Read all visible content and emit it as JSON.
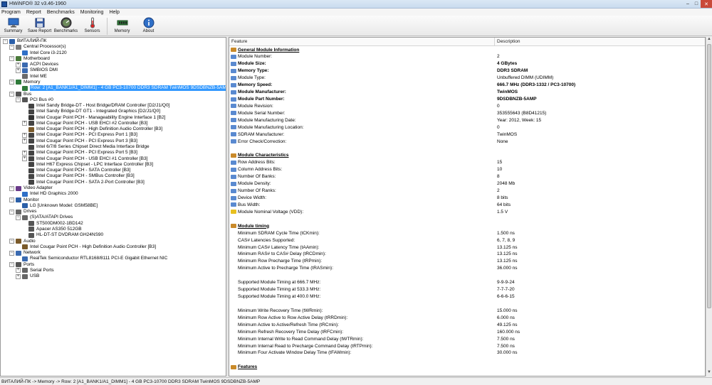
{
  "window": {
    "title": "HWiNFO® 32 v3.46-1960"
  },
  "menu": [
    "Program",
    "Report",
    "Benchmarks",
    "Monitoring",
    "Help"
  ],
  "toolbar": [
    {
      "label": "Summary",
      "icon": "monitor-icon"
    },
    {
      "label": "Save Report",
      "icon": "floppy-disk-icon"
    },
    {
      "label": "Benchmarks",
      "icon": "gauge-icon"
    },
    {
      "label": "Sensors",
      "icon": "thermometer-icon"
    },
    {
      "label": "Memory",
      "icon": "memory-module-icon"
    },
    {
      "label": "About",
      "icon": "info-icon"
    }
  ],
  "tree": [
    {
      "label": "ВИТАЛИЙ-ПК",
      "expander": "−"
    },
    {
      "label": "Central Processor(s)",
      "expander": "−"
    },
    {
      "label": "Intel Core i3-2120",
      "expander": ""
    },
    {
      "label": "Motherboard",
      "expander": "−"
    },
    {
      "label": "ACPI Devices",
      "expander": "+"
    },
    {
      "label": "SMBIOS DMI",
      "expander": "+"
    },
    {
      "label": "Intel ME",
      "expander": ""
    },
    {
      "label": "Memory",
      "expander": "−"
    },
    {
      "label": "Row: 2 [A1_BANK1/A1_DIMM1] - 4 GB PC3-10700 DDR3 SDRAM TwinMOS 9DSDBNZB-5AMP",
      "expander": "",
      "selected": true
    },
    {
      "label": "Bus",
      "expander": "−"
    },
    {
      "label": "PCI Bus #0",
      "expander": "−"
    },
    {
      "label": "Intel Sandy Bridge-DT - Host Bridge/DRAM Controller [D2/J1/Q0]",
      "expander": ""
    },
    {
      "label": "Intel Sandy Bridge-DT GT1 - Integrated Graphics [D2/J1/Q0]",
      "expander": ""
    },
    {
      "label": "Intel Cougar Point PCH - Manageability Engine Interface 1 [B2]",
      "expander": ""
    },
    {
      "label": "Intel Cougar Point PCH - USB EHCI #2 Controller [B3]",
      "expander": "+"
    },
    {
      "label": "Intel Cougar Point PCH - High Definition Audio Controller [B3]",
      "expander": ""
    },
    {
      "label": "Intel Cougar Point PCH - PCI Express Port 1 [B3]",
      "expander": "+"
    },
    {
      "label": "Intel Cougar Point PCH - PCI Express Port 3 [B3]",
      "expander": "+"
    },
    {
      "label": "Intel 6/7/8 Series Chipset Direct Media Interface Bridge",
      "expander": ""
    },
    {
      "label": "Intel Cougar Point PCH - PCI Express Port 5 [B3]",
      "expander": "+"
    },
    {
      "label": "Intel Cougar Point PCH - USB EHCI #1 Controller [B3]",
      "expander": "+"
    },
    {
      "label": "Intel H67 Express Chipset - LPC Interface Controller [B3]",
      "expander": ""
    },
    {
      "label": "Intel Cougar Point PCH - SATA Controller [B3]",
      "expander": ""
    },
    {
      "label": "Intel Cougar Point PCH - SMBus Controller [B3]",
      "expander": ""
    },
    {
      "label": "Intel Cougar Point PCH - SATA 2-Port Controller [B3]",
      "expander": ""
    },
    {
      "label": "Video Adapter",
      "expander": "−"
    },
    {
      "label": "Intel HD Graphics 2000",
      "expander": ""
    },
    {
      "label": "Monitor",
      "expander": "−"
    },
    {
      "label": "LG [Unknown Model: GSM58BE]",
      "expander": ""
    },
    {
      "label": "Drives",
      "expander": "−"
    },
    {
      "label": "(S)ATA/ATAPI Drives",
      "expander": "−"
    },
    {
      "label": "ST500DM002-1BD142",
      "expander": ""
    },
    {
      "label": "Apacer AS350 512GB",
      "expander": ""
    },
    {
      "label": "HL-DT-ST DVDRAM GH24NS90",
      "expander": ""
    },
    {
      "label": "Audio",
      "expander": "−"
    },
    {
      "label": "Intel Cougar Point PCH - High Definition Audio Controller [B3]",
      "expander": ""
    },
    {
      "label": "Network",
      "expander": "−"
    },
    {
      "label": "RealTek Semiconductor RTL8168/8111 PCI-E Gigabit Ethernet NIC",
      "expander": ""
    },
    {
      "label": "Ports",
      "expander": "−"
    },
    {
      "label": "Serial Ports",
      "expander": "+"
    },
    {
      "label": "USB",
      "expander": "+"
    }
  ],
  "details": {
    "header_feature": "Feature",
    "header_description": "Description",
    "rows": [
      {
        "f": "General Module Information",
        "d": "",
        "type": "section"
      },
      {
        "f": "Module Number:",
        "d": "2"
      },
      {
        "f": "Module Size:",
        "d": "4 GBytes",
        "bold": true
      },
      {
        "f": "Memory Type:",
        "d": "DDR3 SDRAM",
        "bold": true
      },
      {
        "f": "Module Type:",
        "d": "Unbuffered DIMM (UDIMM)"
      },
      {
        "f": "Memory Speed:",
        "d": "666.7 MHz (DDR3-1332 / PC3-10700)",
        "bold": true
      },
      {
        "f": "Module Manufacturer:",
        "d": "TwinMOS",
        "bold": true
      },
      {
        "f": "Module Part Number:",
        "d": "9DSDBNZB-5AMP",
        "bold": true
      },
      {
        "f": "Module Revision:",
        "d": "0"
      },
      {
        "f": "Module Serial Number:",
        "d": "353555643 (B8D41215)"
      },
      {
        "f": "Module Manufacturing Date:",
        "d": "Year: 2012, Week: 15"
      },
      {
        "f": "Module Manufacturing Location:",
        "d": "0"
      },
      {
        "f": "SDRAM Manufacturer:",
        "d": "TwinMOS"
      },
      {
        "f": "Error Check/Correction:",
        "d": "None"
      },
      {
        "f": "",
        "d": "",
        "type": "blank"
      },
      {
        "f": "Module Characteristics",
        "d": "",
        "type": "section"
      },
      {
        "f": "Row Address Bits:",
        "d": "15"
      },
      {
        "f": "Column Address Bits:",
        "d": "10"
      },
      {
        "f": "Number Of Banks:",
        "d": "8"
      },
      {
        "f": "Module Density:",
        "d": "2048 Mb"
      },
      {
        "f": "Number Of Ranks:",
        "d": "2"
      },
      {
        "f": "Device Width:",
        "d": "8 bits"
      },
      {
        "f": "Bus Width:",
        "d": "64 bits"
      },
      {
        "f": "Module Nominal Voltage (VDD):",
        "d": "1.5 V",
        "icon": "lightning-icon"
      },
      {
        "f": "",
        "d": "",
        "type": "blank"
      },
      {
        "f": "Module timing",
        "d": "",
        "type": "section"
      },
      {
        "f": "Minimum SDRAM Cycle Time (tCKmin):",
        "d": "1.500 ns",
        "type": "sub"
      },
      {
        "f": "CAS# Latencies Supported:",
        "d": "6, 7, 8, 9",
        "type": "sub"
      },
      {
        "f": "Minimum CAS# Latency Time (tAAmin):",
        "d": "13.125 ns",
        "type": "sub"
      },
      {
        "f": "Minimum RAS# to CAS# Delay (tRCDmin):",
        "d": "13.125 ns",
        "type": "sub"
      },
      {
        "f": "Minimum Row Precharge Time (tRPmin):",
        "d": "13.125 ns",
        "type": "sub"
      },
      {
        "f": "Minimum Active to Precharge Time (tRASmin):",
        "d": "36.000 ns",
        "type": "sub"
      },
      {
        "f": "",
        "d": "",
        "type": "blank"
      },
      {
        "f": "Supported Module Timing at 666.7 MHz:",
        "d": "9-9-9-24",
        "type": "sub"
      },
      {
        "f": "Supported Module Timing at 533.3 MHz:",
        "d": "7-7-7-20",
        "type": "sub"
      },
      {
        "f": "Supported Module Timing at 400.0 MHz:",
        "d": "6-6-6-15",
        "type": "sub"
      },
      {
        "f": "",
        "d": "",
        "type": "blank"
      },
      {
        "f": "Minimum Write Recovery Time (tWRmin):",
        "d": "15.000 ns",
        "type": "sub"
      },
      {
        "f": "Minimum Row Active to Row Active Delay (tRRDmin):",
        "d": "6.000 ns",
        "type": "sub"
      },
      {
        "f": "Minimum Active to Active/Refresh Time (tRCmin):",
        "d": "49.125 ns",
        "type": "sub"
      },
      {
        "f": "Minimum Refresh Recovery Time Delay (tRFCmin):",
        "d": "160.000 ns",
        "type": "sub"
      },
      {
        "f": "Minimum Internal Write to Read Command Delay (tWTRmin):",
        "d": "7.500 ns",
        "type": "sub"
      },
      {
        "f": "Minimum Internal Read to Precharge Command Delay (tRTPmin):",
        "d": "7.500 ns",
        "type": "sub"
      },
      {
        "f": "Minimum Four Activate Window Delay Time (tFAWmin):",
        "d": "30.000 ns",
        "type": "sub"
      },
      {
        "f": "",
        "d": "",
        "type": "blank"
      },
      {
        "f": "Features",
        "d": "",
        "type": "section"
      }
    ]
  },
  "status": {
    "text": "ВИТАЛИЙ-ПК -> Memory -> Row: 2 [A1_BANK1/A1_DIMM1] - 4 GB PC3-10700 DDR3 SDRAM TwinMOS 9DSDBNZB-5AMP"
  }
}
